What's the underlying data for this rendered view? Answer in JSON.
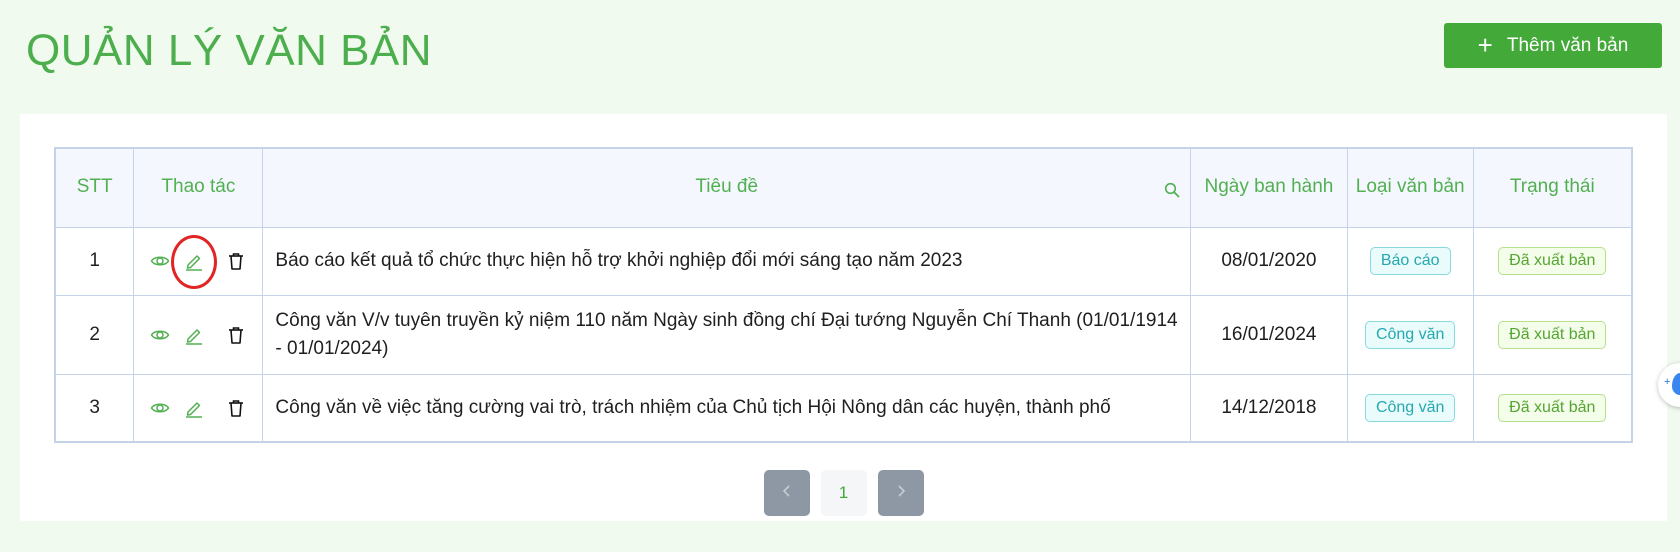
{
  "header": {
    "title": "QUẢN LÝ VĂN BẢN",
    "add_button_label": "Thêm văn bản"
  },
  "table": {
    "columns": {
      "stt": "STT",
      "actions": "Thao tác",
      "title": "Tiêu đề",
      "date": "Ngày ban hành",
      "type": "Loại văn bản",
      "status": "Trạng thái"
    },
    "rows": [
      {
        "stt": "1",
        "title": "Báo cáo kết quả tổ chức thực hiện hỗ trợ khởi nghiệp đổi mới sáng tạo năm 2023",
        "date": "08/01/2020",
        "type": "Báo cáo",
        "status": "Đã xuất bản"
      },
      {
        "stt": "2",
        "title": "Công văn V/v tuyên truyền kỷ niệm 110 năm Ngày sinh đồng chí Đại tướng Nguyễn Chí Thanh (01/01/1914 - 01/01/2024)",
        "date": "16/01/2024",
        "type": "Công văn",
        "status": "Đã xuất bản"
      },
      {
        "stt": "3",
        "title": "Công văn về việc tăng cường vai trò, trách nhiệm của Chủ tịch Hội Nông dân các huyện, thành phố",
        "date": "14/12/2018",
        "type": "Công văn",
        "status": "Đã xuất bản"
      }
    ]
  },
  "pagination": {
    "current_page": "1"
  },
  "icons": {
    "view": "eye-icon",
    "edit": "pencil-icon",
    "delete": "trash-icon",
    "search": "search-icon",
    "prev": "chevron-left-icon",
    "next": "chevron-right-icon",
    "add": "plus-icon"
  },
  "colors": {
    "accent": "#43a939",
    "background": "#f1faee",
    "highlight_circle": "#e12525"
  }
}
